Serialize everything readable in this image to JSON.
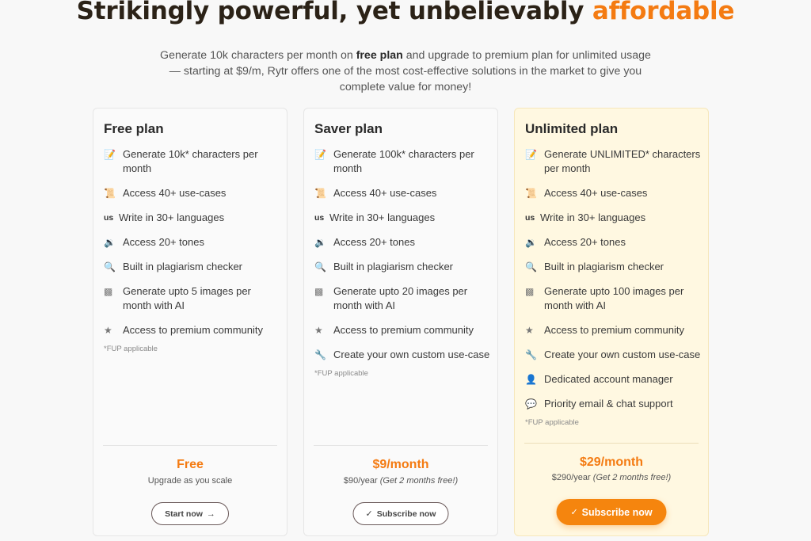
{
  "header": {
    "title_main": "Strikingly powerful, yet unbelievably",
    "title_accent": "affordable",
    "subtitle_pre": "Generate 10k characters per month on",
    "subtitle_bold": "free plan",
    "subtitle_post": "and upgrade to premium plan for unlimited usage — starting at $9/m, Rytr offers one of the most cost-effective solutions in the market to give you complete value for money!"
  },
  "colors": {
    "accent": "#f47b12",
    "unlimited_bg": "#fff8e1",
    "button_orange": "#f5850e"
  },
  "plans": [
    {
      "name": "Free plan",
      "features": [
        {
          "icon": "memo-icon",
          "glyph": "📝",
          "text": "Generate 10k* characters per month"
        },
        {
          "icon": "scroll-icon",
          "glyph": "📜",
          "text": "Access 40+ use-cases"
        },
        {
          "icon": "us-icon",
          "glyph": "us",
          "text": "Write in 30+ languages"
        },
        {
          "icon": "speaker-icon",
          "glyph": "🔉",
          "text": "Access 20+ tones"
        },
        {
          "icon": "magnifier-icon",
          "glyph": "🔍",
          "text": "Built in plagiarism checker"
        },
        {
          "icon": "image-icon",
          "glyph": "▩",
          "text": "Generate upto 5 images per month with AI"
        },
        {
          "icon": "star-icon",
          "glyph": "★",
          "text": "Access to premium community"
        }
      ],
      "fup": "*FUP applicable",
      "price": "Free",
      "price_sub": "Upgrade as you scale",
      "price_sub_italic": "",
      "button": "Start now",
      "button_icon": "→"
    },
    {
      "name": "Saver plan",
      "features": [
        {
          "icon": "memo-icon",
          "glyph": "📝",
          "text": "Generate 100k* characters per month"
        },
        {
          "icon": "scroll-icon",
          "glyph": "📜",
          "text": "Access 40+ use-cases"
        },
        {
          "icon": "us-icon",
          "glyph": "us",
          "text": "Write in 30+ languages"
        },
        {
          "icon": "speaker-icon",
          "glyph": "🔉",
          "text": "Access 20+ tones"
        },
        {
          "icon": "magnifier-icon",
          "glyph": "🔍",
          "text": "Built in plagiarism checker"
        },
        {
          "icon": "image-icon",
          "glyph": "▩",
          "text": "Generate upto 20 images per month with AI"
        },
        {
          "icon": "star-icon",
          "glyph": "★",
          "text": "Access to premium community"
        },
        {
          "icon": "wrench-icon",
          "glyph": "🔧",
          "text": "Create your own custom use-case"
        }
      ],
      "fup": "*FUP applicable",
      "price": "$9/month",
      "price_sub": "$90/year",
      "price_sub_italic": "(Get 2 months free!)",
      "button": "Subscribe now",
      "button_icon": "✓"
    },
    {
      "name": "Unlimited plan",
      "features": [
        {
          "icon": "memo-icon",
          "glyph": "📝",
          "text": "Generate UNLIMITED* characters per month"
        },
        {
          "icon": "scroll-icon",
          "glyph": "📜",
          "text": "Access 40+ use-cases"
        },
        {
          "icon": "us-icon",
          "glyph": "us",
          "text": "Write in 30+ languages"
        },
        {
          "icon": "speaker-icon",
          "glyph": "🔉",
          "text": "Access 20+ tones"
        },
        {
          "icon": "magnifier-icon",
          "glyph": "🔍",
          "text": "Built in plagiarism checker"
        },
        {
          "icon": "image-icon",
          "glyph": "▩",
          "text": "Generate upto 100 images per month with AI"
        },
        {
          "icon": "star-icon",
          "glyph": "★",
          "text": "Access to premium community"
        },
        {
          "icon": "wrench-icon",
          "glyph": "🔧",
          "text": "Create your own custom use-case"
        },
        {
          "icon": "person-icon",
          "glyph": "👤",
          "text": "Dedicated account manager"
        },
        {
          "icon": "speech-bubble-icon",
          "glyph": "💬",
          "text": "Priority email & chat support"
        }
      ],
      "fup": "*FUP applicable",
      "price": "$29/month",
      "price_sub": "$290/year",
      "price_sub_italic": "(Get 2 months free!)",
      "button": "Subscribe now",
      "button_icon": "✓"
    }
  ]
}
